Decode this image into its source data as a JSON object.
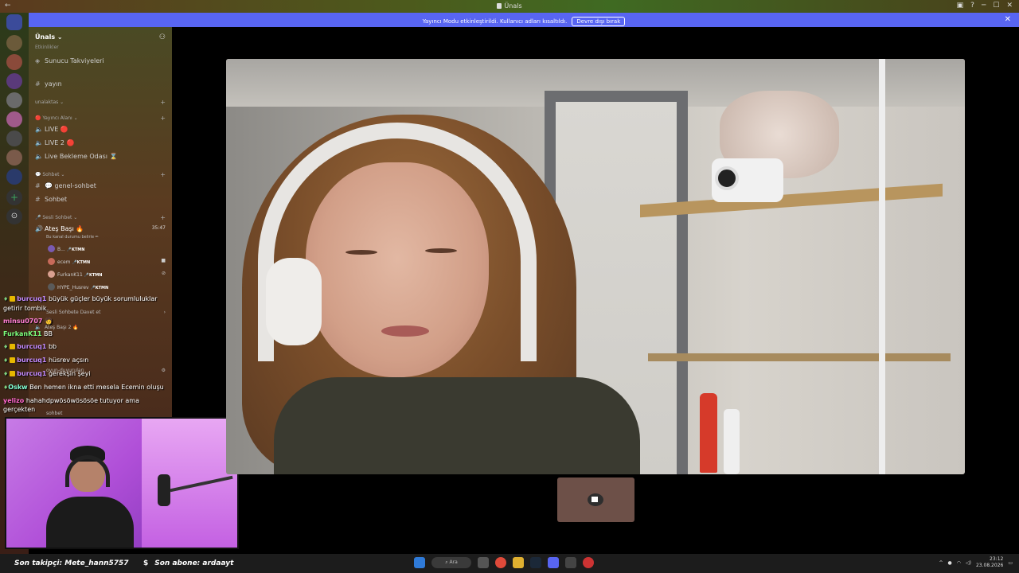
{
  "window": {
    "back": "←",
    "title": "Ünals",
    "controls": [
      "▣",
      "?",
      "─",
      "☐",
      "✕"
    ]
  },
  "banner": {
    "message": "Yayıncı Modu etkinleştirildi. Kullanıcı adları kısaltıldı.",
    "button": "Devre dışı bırak",
    "close": "✕"
  },
  "sidebar": {
    "guild": "Ünals ⌄",
    "clipped_top": "Etkinlikler",
    "boost": "Sunucu Takviyeleri",
    "channel_yayin": "yayın",
    "cat_unalaktas": "unalaktas ⌄",
    "cat_yayinci_alani": "🔴 Yayıncı Alanı ⌄",
    "live1": "LIVE 🔴",
    "live2": "LIVE 2 🔴",
    "live_wait": "Live Bekleme Odası ⌛",
    "cat_sohbet": "💬 Sohbet ⌄",
    "genel_sohbet": "💬 genel-sohbet",
    "sohbet": "Sohbet",
    "cat_sesli": "🎤 Sesli Sohbet ⌄",
    "ates_basi": "Ateş Başı 🔥",
    "ates_timer": "35:47",
    "ates_desc": "Bu kanal durumu belirle ✏",
    "members": [
      {
        "name": "B...",
        "tag": "🎤KTMN"
      },
      {
        "name": "ecem",
        "tag": "🎤KTMN"
      },
      {
        "name": "FurkanK11",
        "tag": "🎤KTMN"
      },
      {
        "name": "HYPE_Husrev",
        "tag": "🎤KTMN"
      }
    ],
    "invite": "Sesli Sohbete Davet et",
    "ates_basi_2": "Ateş Başı 2 🔥",
    "oyun": "oyun-duyuruları",
    "sohbet2": "sohbet"
  },
  "chat": [
    {
      "user": "burcuq1",
      "color": "#c58bff",
      "badge": true,
      "text": "büyük güçler büyük sorumluluklar getirir tombik"
    },
    {
      "user": "minsu0707",
      "color": "#ff7fd4",
      "badge": false,
      "text": "🧑"
    },
    {
      "user": "FurkanK11",
      "color": "#7dff7d",
      "badge": false,
      "text": "BB"
    },
    {
      "user": "burcuq1",
      "color": "#c58bff",
      "badge": true,
      "text": "bb"
    },
    {
      "user": "burcuq1",
      "color": "#c58bff",
      "badge": true,
      "text": "hüsrev açsın"
    },
    {
      "user": "burcuq1",
      "color": "#c58bff",
      "badge": true,
      "text": "gerekşin şeyi"
    },
    {
      "user": "Oskw",
      "color": "#7fffd4",
      "badge": false,
      "text": "Ben hemen ikna etti mesela Ecemin oluşu"
    },
    {
      "user": "yelizo",
      "color": "#ff66cc",
      "badge": false,
      "text": "hahahdpwösöwösösöe tutuyor ama gerçekten"
    }
  ],
  "bottom": {
    "follower_label": "Son takipçi: Mete_hann5757",
    "sub_label": "Son abone: ardaayt",
    "search": "Ara",
    "time": "23:12",
    "date": "23.08.2026"
  },
  "colors": {
    "blurple": "#5865f2",
    "live_red": "#da373c"
  }
}
